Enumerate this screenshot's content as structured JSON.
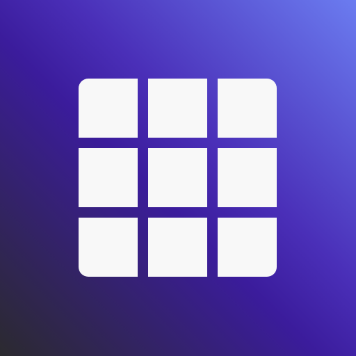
{
  "icon": {
    "name": "grid-icon",
    "rows": 3,
    "columns": 3
  },
  "colors": {
    "background_start": "#2b2a2f",
    "background_mid": "#3b1c9c",
    "background_end": "#6b7cf0",
    "tile": "#f8f8f8"
  }
}
